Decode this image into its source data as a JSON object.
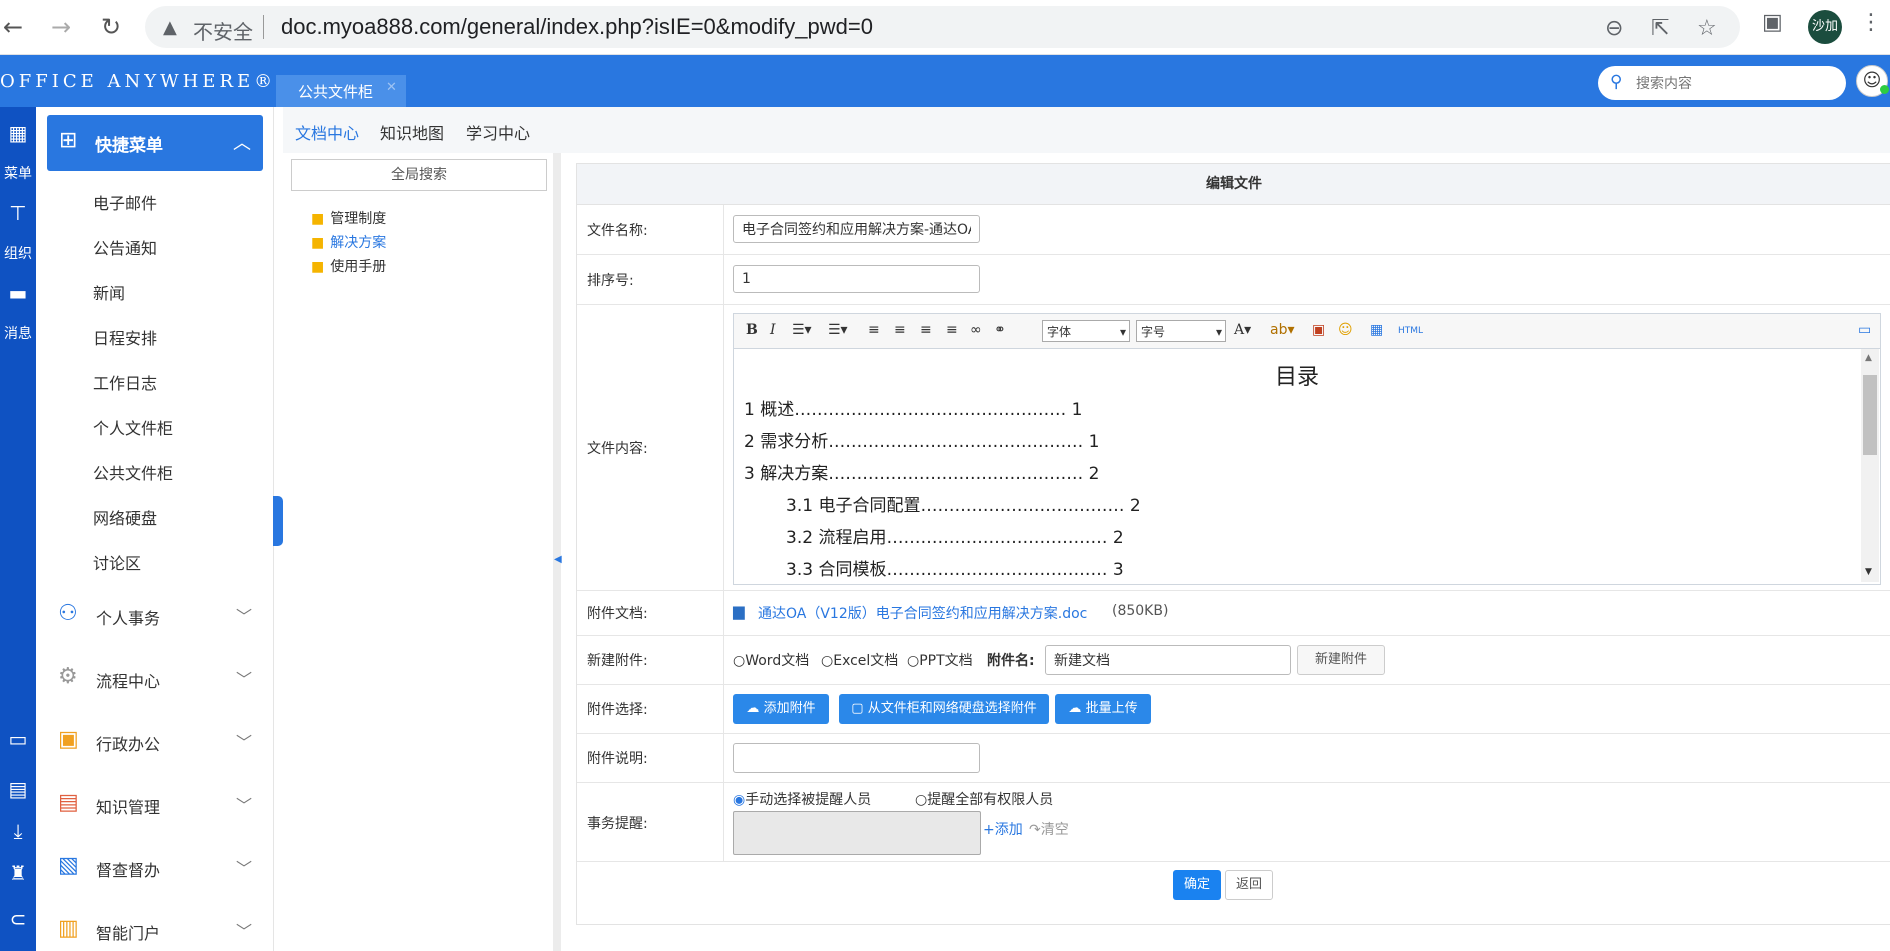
{
  "browser": {
    "security_label": "不安全",
    "url": "doc.myoa888.com/general/index.php?isIE=0&modify_pwd=0",
    "profile_initials": "沙加"
  },
  "app": {
    "logo": "OFFICE ANYWHERE®",
    "active_tab": "公共文件柜",
    "search_placeholder": "搜索内容"
  },
  "rail": {
    "items": [
      {
        "icon": "grid-icon",
        "label": "菜单"
      },
      {
        "icon": "org-icon",
        "label": "组织"
      },
      {
        "icon": "message-icon",
        "label": "消息"
      }
    ]
  },
  "menu": {
    "header": "快捷菜单",
    "items": [
      "电子邮件",
      "公告通知",
      "新闻",
      "日程安排",
      "工作日志",
      "个人文件柜",
      "公共文件柜",
      "网络硬盘",
      "讨论区"
    ],
    "sections": [
      {
        "label": "个人事务",
        "icon": "person-icon",
        "color": "#2977e0"
      },
      {
        "label": "流程中心",
        "icon": "flow-icon",
        "color": "#999999"
      },
      {
        "label": "行政办公",
        "icon": "briefcase-icon",
        "color": "#f0a020"
      },
      {
        "label": "知识管理",
        "icon": "book-icon",
        "color": "#e06040"
      },
      {
        "label": "督查督办",
        "icon": "inspect-icon",
        "color": "#2977e0"
      },
      {
        "label": "智能门户",
        "icon": "portal-icon",
        "color": "#f0a020"
      }
    ]
  },
  "subnav": {
    "tabs": [
      "文档中心",
      "知识地图",
      "学习中心"
    ]
  },
  "tree": {
    "search_label": "全局搜索",
    "folders": [
      "管理制度",
      "解决方案",
      "使用手册"
    ]
  },
  "form": {
    "title": "编辑文件",
    "labels": {
      "filename": "文件名称:",
      "order": "排序号:",
      "content": "文件内容:",
      "attachment": "附件文档:",
      "new_attachment": "新建附件:",
      "select_attachment": "附件选择:",
      "attachment_desc": "附件说明:",
      "reminder": "事务提醒:"
    },
    "filename_value": "电子合同签约和应用解决方案-通达OA",
    "order_value": "1",
    "editor": {
      "font_label": "字体",
      "size_label": "字号",
      "toc_title": "目录",
      "toc": [
        "1 概述………………………………………… 1",
        "2 需求分析……………………………………… 1",
        "3 解决方案……………………………………… 2",
        "3.1 电子合同配置……………………………… 2",
        "3.2 流程启用………………………………… 2",
        "3.3 合同模板………………………………… 3"
      ]
    },
    "attachment_file": "通达OA（V12版）电子合同签约和应用解决方案.doc",
    "attachment_size": "(850KB)",
    "new_attach": {
      "opt_word": "Word文档",
      "opt_excel": "Excel文档",
      "opt_ppt": "PPT文档",
      "name_label": "附件名:",
      "name_value": "新建文档",
      "button": "新建附件"
    },
    "select_buttons": [
      "添加附件",
      "从文件柜和网络硬盘选择附件",
      "批量上传"
    ],
    "desc_value": "",
    "reminder": {
      "opt_manual": "手动选择被提醒人员",
      "opt_all": "提醒全部有权限人员",
      "add": "添加",
      "clear": "清空"
    },
    "ok": "确定",
    "back": "返回"
  }
}
